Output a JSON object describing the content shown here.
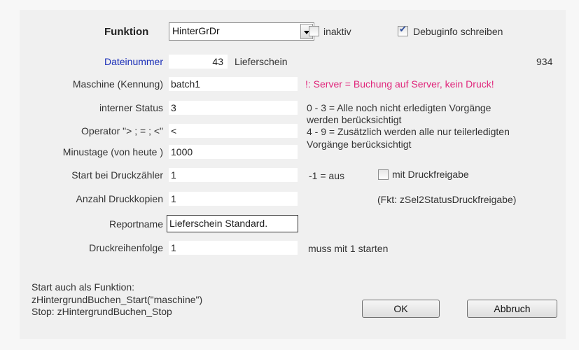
{
  "header": {
    "funktion_label": "Funktion",
    "funktion_value": "HinterGrDr",
    "inaktiv_label": "inaktiv",
    "inaktiv_checked": false,
    "debug_label": "Debuginfo schreiben",
    "debug_checked": true
  },
  "dateinummer": {
    "label": "Dateinummer",
    "value": "43",
    "name": "Lieferschein",
    "count": "934",
    "label_color": "#1b2fb8"
  },
  "fields": {
    "maschine": {
      "label": "Maschine (Kennung)",
      "value": "batch1"
    },
    "status": {
      "label": "interner Status",
      "value": "3"
    },
    "operator": {
      "label": "Operator \"> ; = ; <\"",
      "value": "<"
    },
    "minustage": {
      "label": "Minustage (von heute )",
      "value": "1000"
    },
    "druckzaehler": {
      "label": "Start bei Druckzähler",
      "value": "1"
    },
    "kopien": {
      "label": "Anzahl Druckkopien",
      "value": "1"
    },
    "reportname": {
      "label": "Reportname",
      "value": "Lieferschein Standard."
    },
    "reihenfolge": {
      "label": "Druckreihenfolge",
      "value": "1"
    }
  },
  "notes": {
    "server_warning": "!:  Server = Buchung auf Server, kein Druck!",
    "server_warning_color": "#e0247a",
    "status_hint_1": "0 - 3 = Alle noch nicht erledigten Vorgänge",
    "status_hint_2": "werden berücksichtigt",
    "status_hint_3": "4 - 9 = Zusätzlich werden alle nur teilerledigten",
    "status_hint_4": "Vorgänge berücksichtigt",
    "aus_hint": "-1 = aus",
    "druckfreigabe_label": "mit Druckfreigabe",
    "druckfreigabe_checked": false,
    "fkt_hint": "(Fkt: zSel2StatusDruckfreigabe)",
    "reihenfolge_hint": "muss mit 1 starten"
  },
  "footer": {
    "line1": "Start auch als Funktion:",
    "line2": "zHintergrundBuchen_Start(\"maschine\")",
    "line3": "Stop: zHintergrundBuchen_Stop",
    "ok_label": "OK",
    "cancel_label": "Abbruch"
  }
}
